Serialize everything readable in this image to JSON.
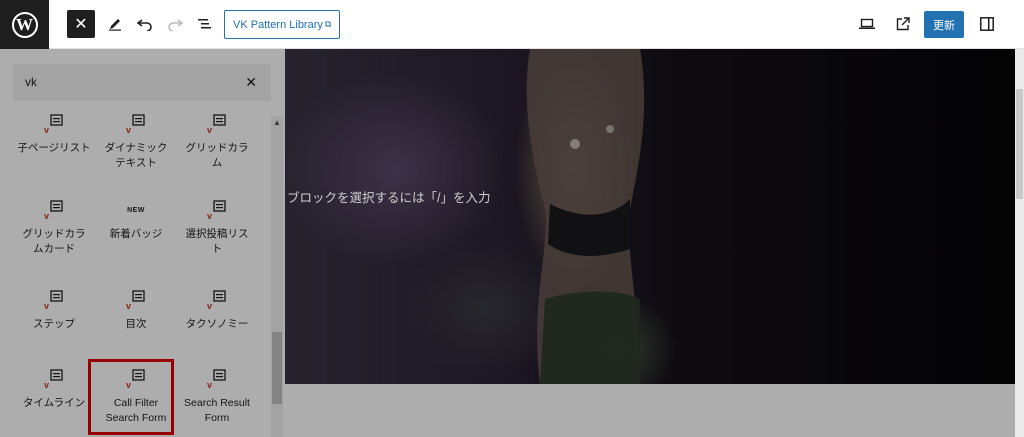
{
  "toolbar": {
    "document_button_label": "VK Pattern Library",
    "update_label": "更新"
  },
  "inserter": {
    "search_value": "vk",
    "items": [
      {
        "label": "子ページリスト"
      },
      {
        "label": "ダイナミック\nテキスト"
      },
      {
        "label": "グリッドカラ\nム"
      },
      {
        "label": "グリッドカラ\nムカード"
      },
      {
        "label": "新着バッジ",
        "badge": "NEW"
      },
      {
        "label": "選択投稿リス\nト"
      },
      {
        "label": "ステップ"
      },
      {
        "label": "目次"
      },
      {
        "label": "タクソノミー"
      },
      {
        "label": "タイムライン"
      },
      {
        "label": "Call Filter\nSearch Form"
      },
      {
        "label": "Search Result\nForm"
      }
    ]
  },
  "editor": {
    "placeholder": "ブロックを選択するには「/」を入力"
  },
  "colors": {
    "accent": "#2271b1",
    "highlight": "#e00000",
    "vk_icon_red": "#c0392b"
  }
}
